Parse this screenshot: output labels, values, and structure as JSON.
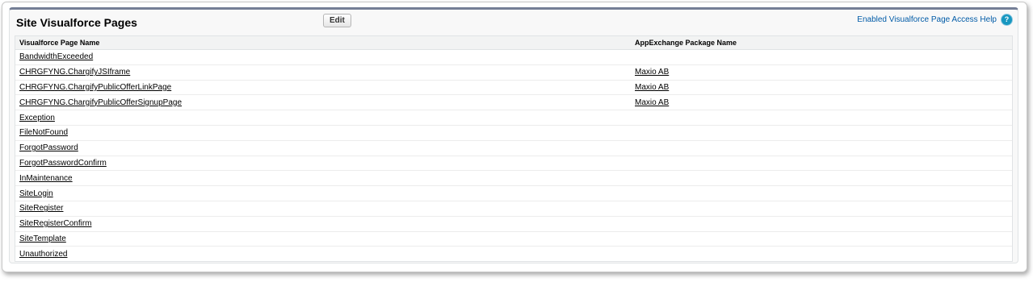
{
  "section": {
    "title": "Site Visualforce Pages",
    "edit_label": "Edit",
    "help_label": "Enabled Visualforce Page Access Help",
    "help_icon": "?"
  },
  "table": {
    "columns": [
      "Visualforce Page Name",
      "AppExchange Package Name"
    ],
    "rows": [
      {
        "page": "BandwidthExceeded",
        "package": ""
      },
      {
        "page": "CHRGFYNG.ChargifyJSIframe",
        "package": "Maxio AB"
      },
      {
        "page": "CHRGFYNG.ChargifyPublicOfferLinkPage",
        "package": "Maxio AB"
      },
      {
        "page": "CHRGFYNG.ChargifyPublicOfferSignupPage",
        "package": "Maxio AB"
      },
      {
        "page": "Exception",
        "package": ""
      },
      {
        "page": "FileNotFound",
        "package": ""
      },
      {
        "page": "ForgotPassword",
        "package": ""
      },
      {
        "page": "ForgotPasswordConfirm",
        "package": ""
      },
      {
        "page": "InMaintenance",
        "package": ""
      },
      {
        "page": "SiteLogin",
        "package": ""
      },
      {
        "page": "SiteRegister",
        "package": ""
      },
      {
        "page": "SiteRegisterConfirm",
        "package": ""
      },
      {
        "page": "SiteTemplate",
        "package": ""
      },
      {
        "page": "Unauthorized",
        "package": ""
      }
    ]
  }
}
